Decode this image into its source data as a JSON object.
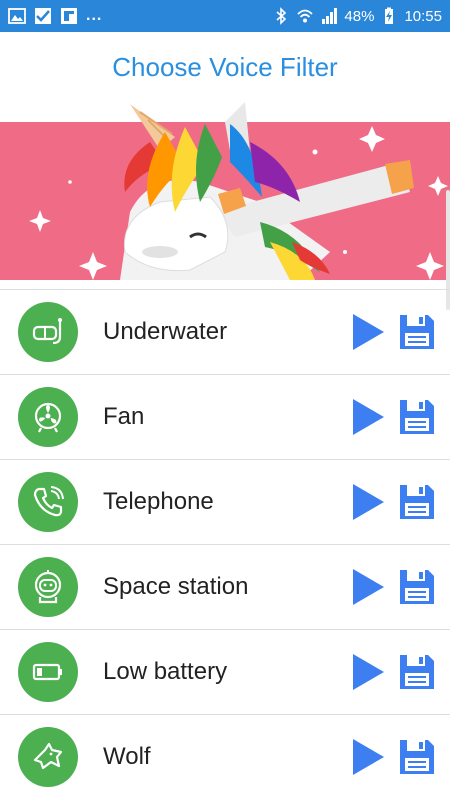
{
  "status_bar": {
    "left_icons": [
      "image-icon",
      "check-icon",
      "flipboard-icon"
    ],
    "more": "...",
    "right_icons": [
      "bluetooth-icon",
      "wifi-icon",
      "signal-icon"
    ],
    "battery_percent": "48%",
    "time": "10:55"
  },
  "header": {
    "title": "Choose Voice Filter"
  },
  "banner": {
    "image": "unicorn-dab-illustration",
    "background_color": "#ef6b86"
  },
  "colors": {
    "accent": "#2a8fe0",
    "action_blue": "#3d7ff0",
    "icon_circle_green": "#4caf50"
  },
  "filters": [
    {
      "label": "Underwater",
      "icon": "diving-mask-icon"
    },
    {
      "label": "Fan",
      "icon": "fan-icon"
    },
    {
      "label": "Telephone",
      "icon": "phone-icon"
    },
    {
      "label": "Space station",
      "icon": "astronaut-icon"
    },
    {
      "label": "Low battery",
      "icon": "low-battery-icon"
    },
    {
      "label": "Wolf",
      "icon": "wolf-icon"
    }
  ]
}
